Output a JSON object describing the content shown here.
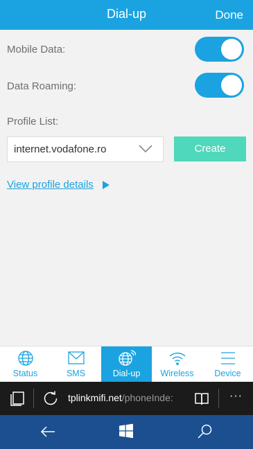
{
  "header": {
    "title": "Dial-up",
    "done_label": "Done"
  },
  "settings": {
    "mobile_data_label": "Mobile Data:",
    "mobile_data_on": true,
    "roaming_label": "Data Roaming:",
    "roaming_on": true,
    "profile_list_label": "Profile List:",
    "profile_selected": "internet.vodafone.ro",
    "create_label": "Create",
    "view_details_label": "View profile details"
  },
  "tabs": [
    {
      "label": "Status",
      "icon": "globe-icon",
      "active": false
    },
    {
      "label": "SMS",
      "icon": "envelope-icon",
      "active": false
    },
    {
      "label": "Dial-up",
      "icon": "globe-signal-icon",
      "active": true
    },
    {
      "label": "Wireless",
      "icon": "wifi-icon",
      "active": false
    },
    {
      "label": "Device",
      "icon": "menu-icon",
      "active": false
    }
  ],
  "browser": {
    "url_host": "tplinkmifi.net",
    "url_path": "/phoneInde:"
  },
  "colors": {
    "accent": "#1aa3e0",
    "create_button": "#4fd8bb",
    "navbar": "#1b4f8f",
    "browser_bar": "#1b1b1b"
  }
}
